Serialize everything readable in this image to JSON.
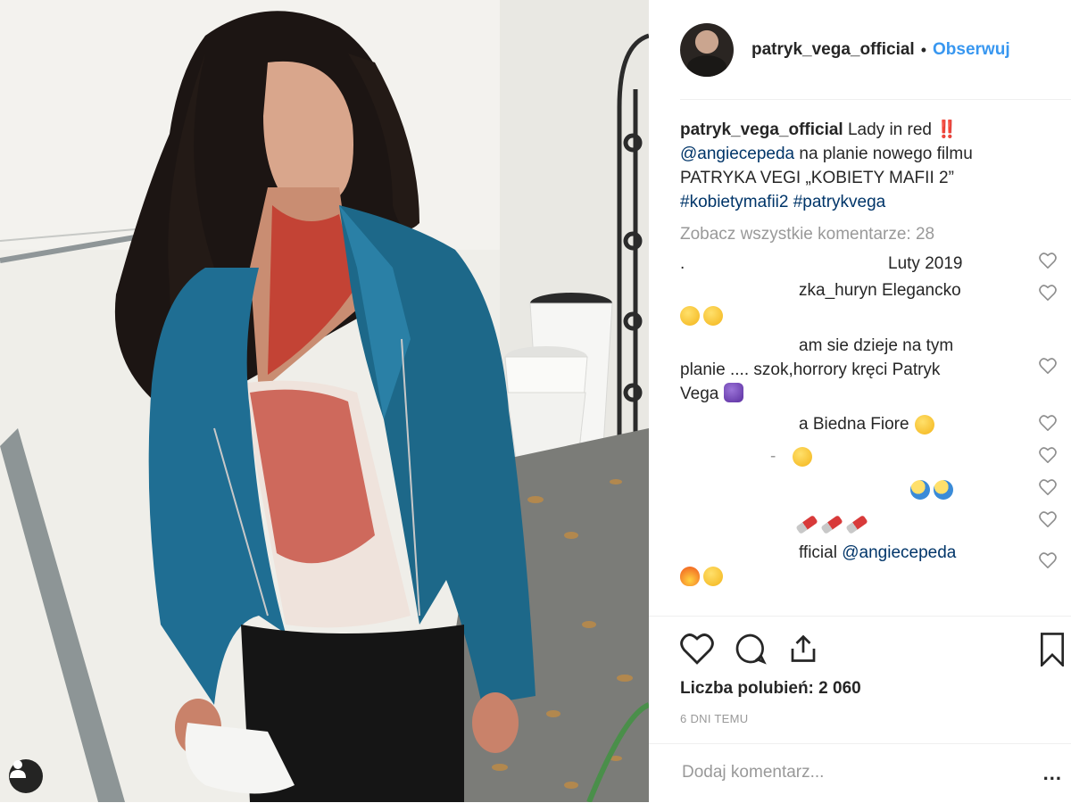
{
  "post": {
    "photo_alt": "",
    "user_tag_icon": "user-silhouette-icon"
  },
  "header": {
    "username": "patryk_vega_official",
    "separator": "•",
    "follow_label": "Obserwuj"
  },
  "caption": {
    "username": "patryk_vega_official",
    "text_1": "Lady in red ‼️",
    "mention": "@angiecepeda",
    "text_2": "na planie nowego filmu PATRYKA VEGI „KOBIETY MAFII 2”",
    "hashtag_1": "#kobietymafii2",
    "hashtag_2": "#patrykvega"
  },
  "view_all_comments": "Zobacz wszystkie komentarze: 28",
  "comments": [
    {
      "text_left": ".",
      "text_right": "Luty 2019"
    },
    {
      "text": "zka_huryn Elegancko"
    },
    {
      "text_1": "am sie dzieje na tym",
      "text_2": "planie .... szok,horrory kręci Patryk",
      "text_3": "Vega"
    },
    {
      "text": "a Biedna Fiore"
    },
    {
      "text": "-"
    },
    {
      "text": ""
    },
    {
      "text": ""
    },
    {
      "text": "fficial",
      "mention": "@angiecepeda"
    }
  ],
  "actions": {
    "like_icon": "heart-outline-icon",
    "comment_icon": "speech-bubble-icon",
    "share_icon": "share-upload-icon",
    "save_icon": "bookmark-icon"
  },
  "likes_label": "Liczba polubień: 2 060",
  "timestamp": "6 DNI TEMU",
  "add_comment": {
    "placeholder": "Dodaj komentarz...",
    "more_label": "..."
  },
  "colors": {
    "link_blue": "#3897f0",
    "mention_blue": "#003569",
    "muted": "#999999",
    "text": "#262626",
    "jacket": "#1f6e93",
    "blood": "#c2362a"
  }
}
